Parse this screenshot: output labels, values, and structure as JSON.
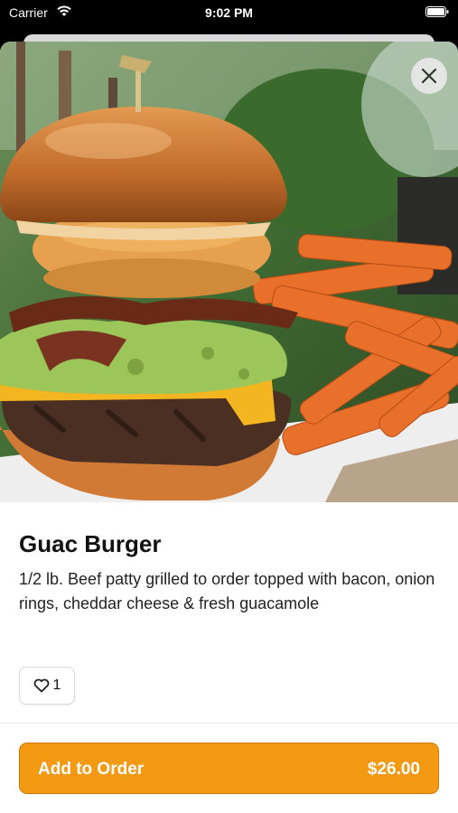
{
  "status_bar": {
    "carrier": "Carrier",
    "time": "9:02 PM"
  },
  "item": {
    "name": "Guac Burger",
    "description": "1/2 lb. Beef patty grilled to order topped with bacon, onion rings, cheddar cheese & fresh guacamole",
    "likes": "1"
  },
  "order": {
    "label": "Add to Order",
    "price": "$26.00"
  },
  "icons": {
    "close": "close-icon",
    "like": "heart-icon",
    "wifi": "wifi-icon",
    "battery": "battery-icon"
  },
  "colors": {
    "accent": "#f39a12"
  }
}
